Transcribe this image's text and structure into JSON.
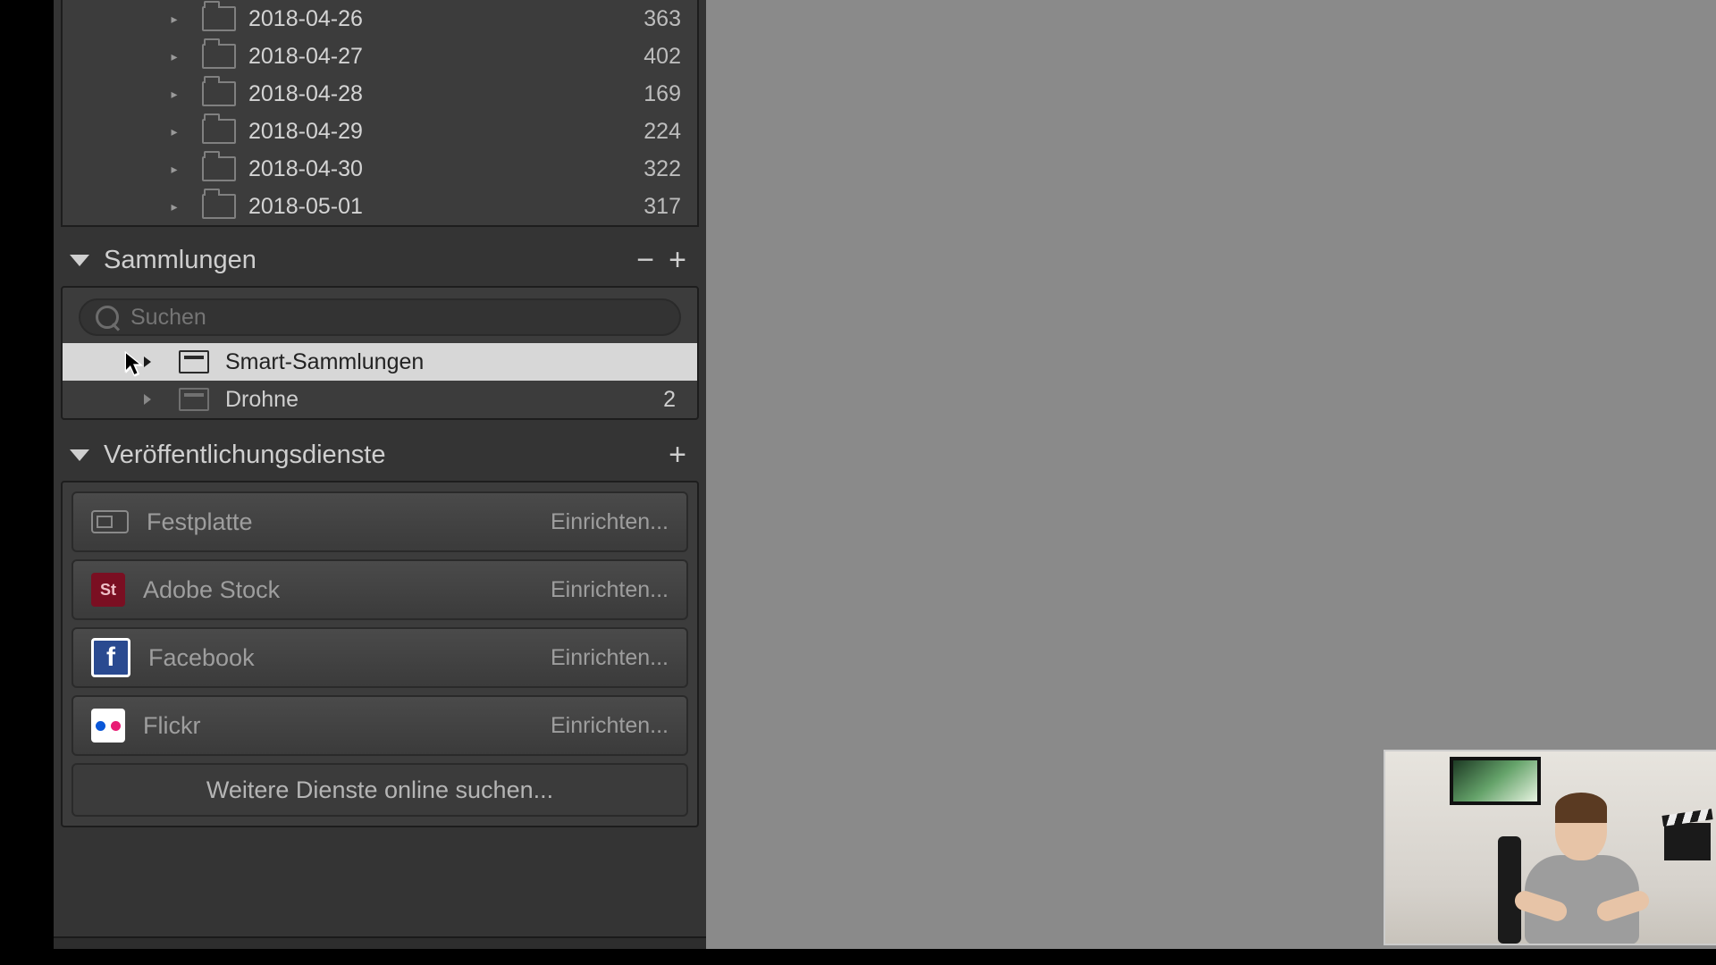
{
  "folders": [
    {
      "name": "2018-04-26",
      "count": "363"
    },
    {
      "name": "2018-04-27",
      "count": "402"
    },
    {
      "name": "2018-04-28",
      "count": "169"
    },
    {
      "name": "2018-04-29",
      "count": "224"
    },
    {
      "name": "2018-04-30",
      "count": "322"
    },
    {
      "name": "2018-05-01",
      "count": "317"
    }
  ],
  "collections": {
    "title": "Sammlungen",
    "search_placeholder": "Suchen",
    "items": [
      {
        "name": "Smart-Sammlungen",
        "count": "",
        "selected": true
      },
      {
        "name": "Drohne",
        "count": "2",
        "selected": false
      }
    ]
  },
  "publish": {
    "title": "Veröffentlichungsdienste",
    "setup_label": "Einrichten...",
    "services": [
      {
        "name": "Festplatte",
        "icon": "hd"
      },
      {
        "name": "Adobe Stock",
        "icon": "stock",
        "badge": "St"
      },
      {
        "name": "Facebook",
        "icon": "fb",
        "badge": "f"
      },
      {
        "name": "Flickr",
        "icon": "flickr"
      }
    ],
    "more_label": "Weitere Dienste online suchen..."
  },
  "buttons": {
    "minus": "−",
    "plus": "+"
  }
}
